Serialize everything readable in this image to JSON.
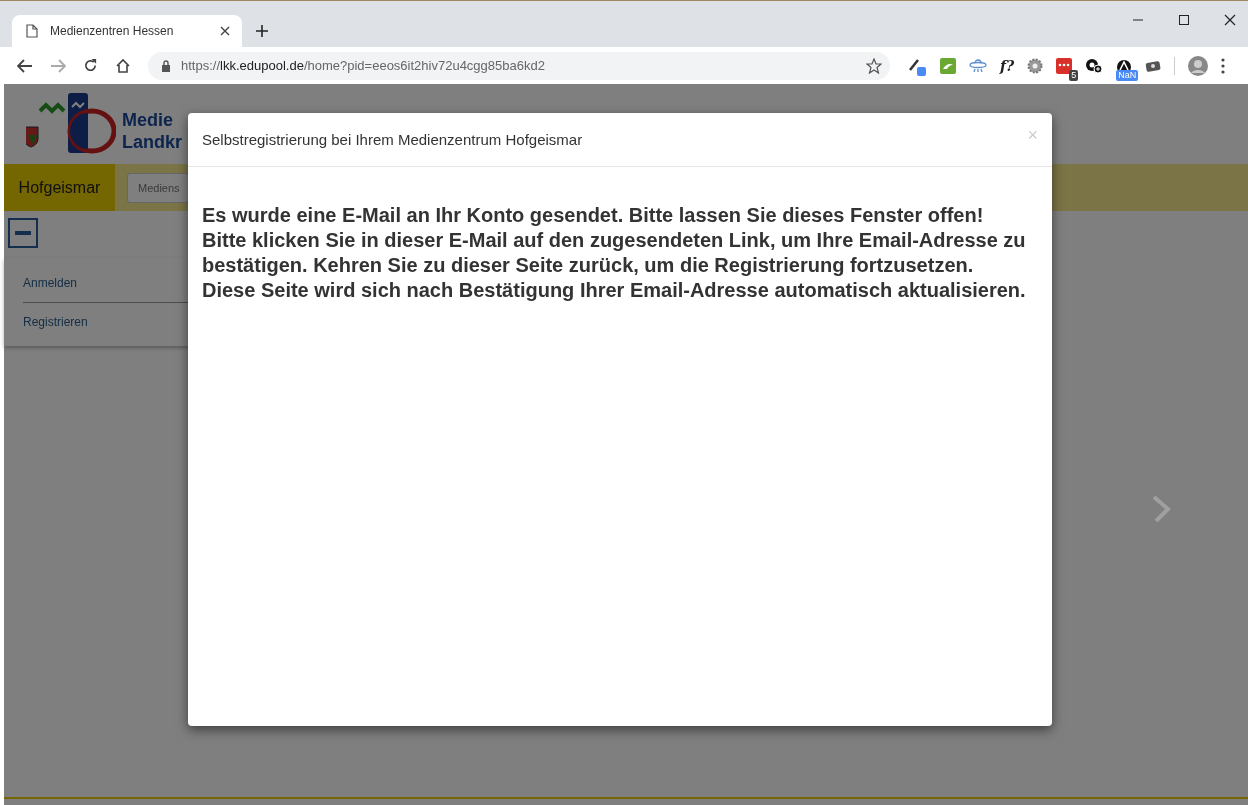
{
  "browser": {
    "tab": {
      "title": "Medienzentren Hessen",
      "selected": true
    },
    "address": {
      "scheme": "https://",
      "host": "lkk.edupool.de",
      "path": "/home?pid=eeos6it2hiv72u4cgg85ba6kd2"
    },
    "extension_label": "f?",
    "extension_badges": [
      {
        "text": "5",
        "color": "#444444"
      },
      {
        "text": "NaN",
        "color": "#4a8af4"
      }
    ]
  },
  "page": {
    "logo_text": [
      "Medie",
      "Landkr"
    ],
    "location": "Hofgeismar",
    "search": {
      "placeholder": "Mediens"
    },
    "menu": [
      {
        "label": "Anmelden"
      },
      {
        "label": "Registrieren"
      }
    ]
  },
  "modal": {
    "title": "Selbstregistrierung bei Ihrem Medienzentrum Hofgeismar",
    "close": "×",
    "message": "Es wurde eine E-Mail an Ihr Konto gesendet. Bitte lassen Sie dieses Fenster offen! Bitte klicken Sie in dieser E-Mail auf den zugesendeten Link, um Ihre Email-Adresse zu bestätigen. Kehren Sie zu dieser Seite zurück, um die Registrierung fortzusetzen. Diese Seite wird sich nach Bestätigung Ihrer Email-Adresse automatisch aktualisieren."
  }
}
